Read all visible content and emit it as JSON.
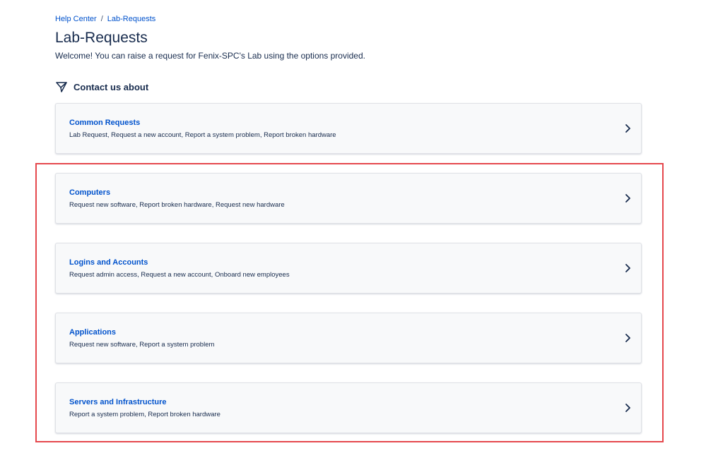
{
  "breadcrumb": {
    "items": [
      "Help Center",
      "Lab-Requests"
    ],
    "separator": "/"
  },
  "page": {
    "title": "Lab-Requests",
    "welcome": "Welcome! You can raise a request for Fenix-SPC's Lab using the options provided."
  },
  "section": {
    "heading": "Contact us about",
    "icon": "paper-plane-icon"
  },
  "cards": [
    {
      "title": "Common Requests",
      "description": "Lab Request, Request a new account, Report a system problem, Report broken hardware"
    },
    {
      "title": "Computers",
      "description": "Request new software, Report broken hardware, Request new hardware"
    },
    {
      "title": "Logins and Accounts",
      "description": "Request admin access, Request a new account, Onboard new employees"
    },
    {
      "title": "Applications",
      "description": "Request new software, Report a system problem"
    },
    {
      "title": "Servers and Infrastructure",
      "description": "Report a system problem, Report broken hardware"
    }
  ],
  "colors": {
    "link": "#0052cc",
    "text": "#172b4d",
    "card_bg": "#f8f9fa",
    "card_border": "#dfe1e6",
    "highlight": "#e5484d"
  }
}
